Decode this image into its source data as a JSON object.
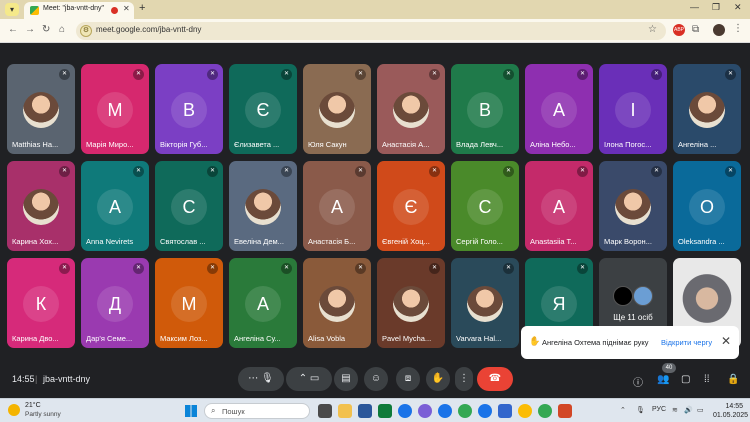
{
  "browser": {
    "tab_title": "Meet: \"jba-vntt-dny\"",
    "tab_close": "✕",
    "new_tab": "+",
    "url": "meet.google.com/jba-vntt-dny",
    "window_controls": [
      "—",
      "❐",
      "✕"
    ],
    "ext_badge": "ABP"
  },
  "participants_row1": [
    {
      "name": "Matthias Ha...",
      "initial": "",
      "color": "#5a6470",
      "photo": true
    },
    {
      "name": "Марія Миро...",
      "initial": "М",
      "color": "#d6286e"
    },
    {
      "name": "Вікторія Губ...",
      "initial": "В",
      "color": "#7b3fc4"
    },
    {
      "name": "Єлизавета ...",
      "initial": "Є",
      "color": "#0f6a5a"
    },
    {
      "name": "Юля Сакун",
      "initial": "",
      "color": "#8a6b52",
      "photo": true
    },
    {
      "name": "Анастасія А...",
      "initial": "",
      "color": "#9a5a5a",
      "photo": true
    },
    {
      "name": "Влада Левч...",
      "initial": "В",
      "color": "#1f7a4a"
    },
    {
      "name": "Аліна Небо...",
      "initial": "А",
      "color": "#8e2fb0"
    },
    {
      "name": "Ілона Погос...",
      "initial": "І",
      "color": "#6a2fb8"
    },
    {
      "name": "Ангеліна ...",
      "initial": "",
      "color": "#2a4a6a",
      "photo": true
    }
  ],
  "participants_row2": [
    {
      "name": "Карина Хох...",
      "initial": "",
      "color": "#a8306a",
      "photo": true
    },
    {
      "name": "Anna Nevirets",
      "initial": "А",
      "color": "#0f7a7a"
    },
    {
      "name": "Святослав ...",
      "initial": "С",
      "color": "#0f6a5a"
    },
    {
      "name": "Евеліна Дем...",
      "initial": "",
      "color": "#5a6a80",
      "photo": true
    },
    {
      "name": "Анастасія Б...",
      "initial": "А",
      "color": "#8a5a4a"
    },
    {
      "name": "Євгеній Хоц...",
      "initial": "Є",
      "color": "#d04a1a"
    },
    {
      "name": "Сергій Голо...",
      "initial": "С",
      "color": "#4a8a2a"
    },
    {
      "name": "Anastasiia T...",
      "initial": "А",
      "color": "#c42a6a"
    },
    {
      "name": "Марк Ворон...",
      "initial": "",
      "color": "#3a4a6a",
      "photo": true
    },
    {
      "name": "Oleksandra ...",
      "initial": "О",
      "color": "#0a6a9a"
    }
  ],
  "participants_row3": [
    {
      "name": "Карина Дво...",
      "initial": "К",
      "color": "#d62a7a"
    },
    {
      "name": "Дар'я Семе...",
      "initial": "Д",
      "color": "#9a3ab0"
    },
    {
      "name": "Максим Лоз...",
      "initial": "М",
      "color": "#d05a0a"
    },
    {
      "name": "Ангеліна Су...",
      "initial": "А",
      "color": "#2a7a3a"
    },
    {
      "name": "Alisa Vobla",
      "initial": "",
      "color": "#8a5a3a",
      "photo": true
    },
    {
      "name": "Pavel Mycha...",
      "initial": "",
      "color": "#6a3a2a",
      "photo": true
    },
    {
      "name": "Varvara Hal...",
      "initial": "",
      "color": "#2a4a5a",
      "photo": true
    },
    {
      "name": "",
      "initial": "Я",
      "color": "#0f6a5a"
    }
  ],
  "more_tile": {
    "label": "Ще 11 осіб"
  },
  "toast": {
    "text": "Ангеліна Охтема піднімає руку",
    "link": "Відкрити чергу"
  },
  "meeting": {
    "time": "14:55",
    "separator": "|",
    "code": "jba-vntt-dny",
    "participant_count": "40"
  },
  "taskbar": {
    "temp": "21°C",
    "weather": "Partly sunny",
    "search_placeholder": "Пошук",
    "lang": "РУС",
    "time": "14:55",
    "date": "01.05.2025"
  },
  "colors": {
    "meet_bg": "#202124",
    "leave_red": "#ea4335",
    "link_blue": "#1a73e8"
  }
}
